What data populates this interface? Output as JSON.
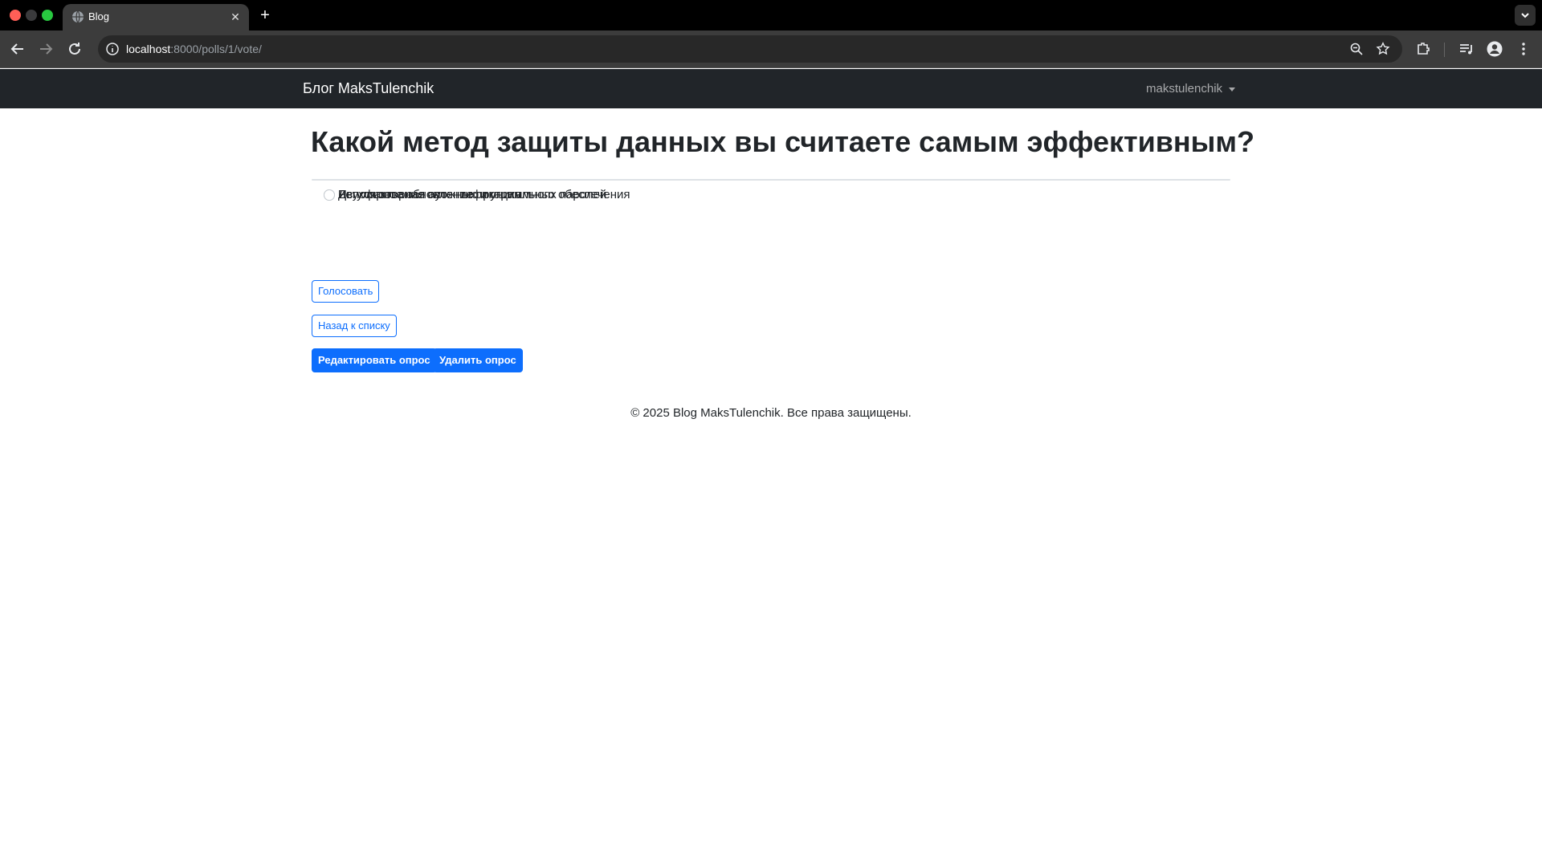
{
  "browser": {
    "tab_title": "Blog",
    "url_host": "localhost",
    "url_path": ":8000/polls/1/vote/"
  },
  "navbar": {
    "brand": "Блог MaksTulenchik",
    "username": "makstulenchik"
  },
  "poll": {
    "question": "Какой метод защиты данных вы считаете самым эффективным?",
    "choices": [
      {
        "label": "Использование сложных и уникальных паролей",
        "selected": false
      },
      {
        "label": "Двухфакторная аутентификация",
        "selected": false
      },
      {
        "label": "Регулярное обновление программного обеспечения",
        "selected": false
      }
    ]
  },
  "actions": {
    "vote": "Голосовать",
    "back": "Назад к списку",
    "edit": "Редактировать опрос",
    "delete": "Удалить опрос"
  },
  "footer": {
    "text": "© 2025 Blog MaksTulenchik. Все права защищены."
  },
  "colors": {
    "navbar_bg": "#212529",
    "primary": "#0d6efd",
    "text": "#212529"
  }
}
